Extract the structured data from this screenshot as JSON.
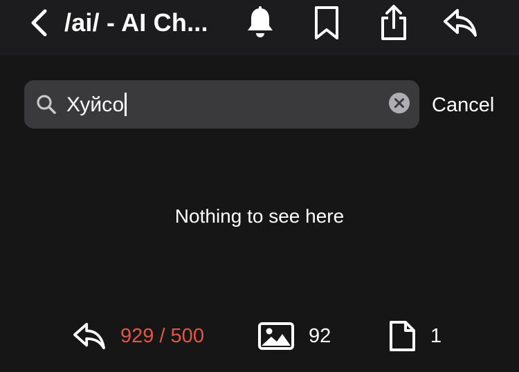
{
  "header": {
    "title": "/ai/ - AI Ch...",
    "icons": [
      "back-chevron-icon",
      "bell-icon",
      "bookmark-icon",
      "share-icon",
      "reply-icon"
    ]
  },
  "search": {
    "value": "Хуйсо",
    "cancel_label": "Cancel"
  },
  "main": {
    "empty_message": "Nothing to see here"
  },
  "stats": {
    "replies": "929 / 500",
    "images": "92",
    "files": "1"
  },
  "colors": {
    "background": "#161616",
    "topbar": "#1c1c1e",
    "search_field": "#3a3a3c",
    "text": "#ffffff",
    "replies_over_limit": "#e0574a"
  }
}
